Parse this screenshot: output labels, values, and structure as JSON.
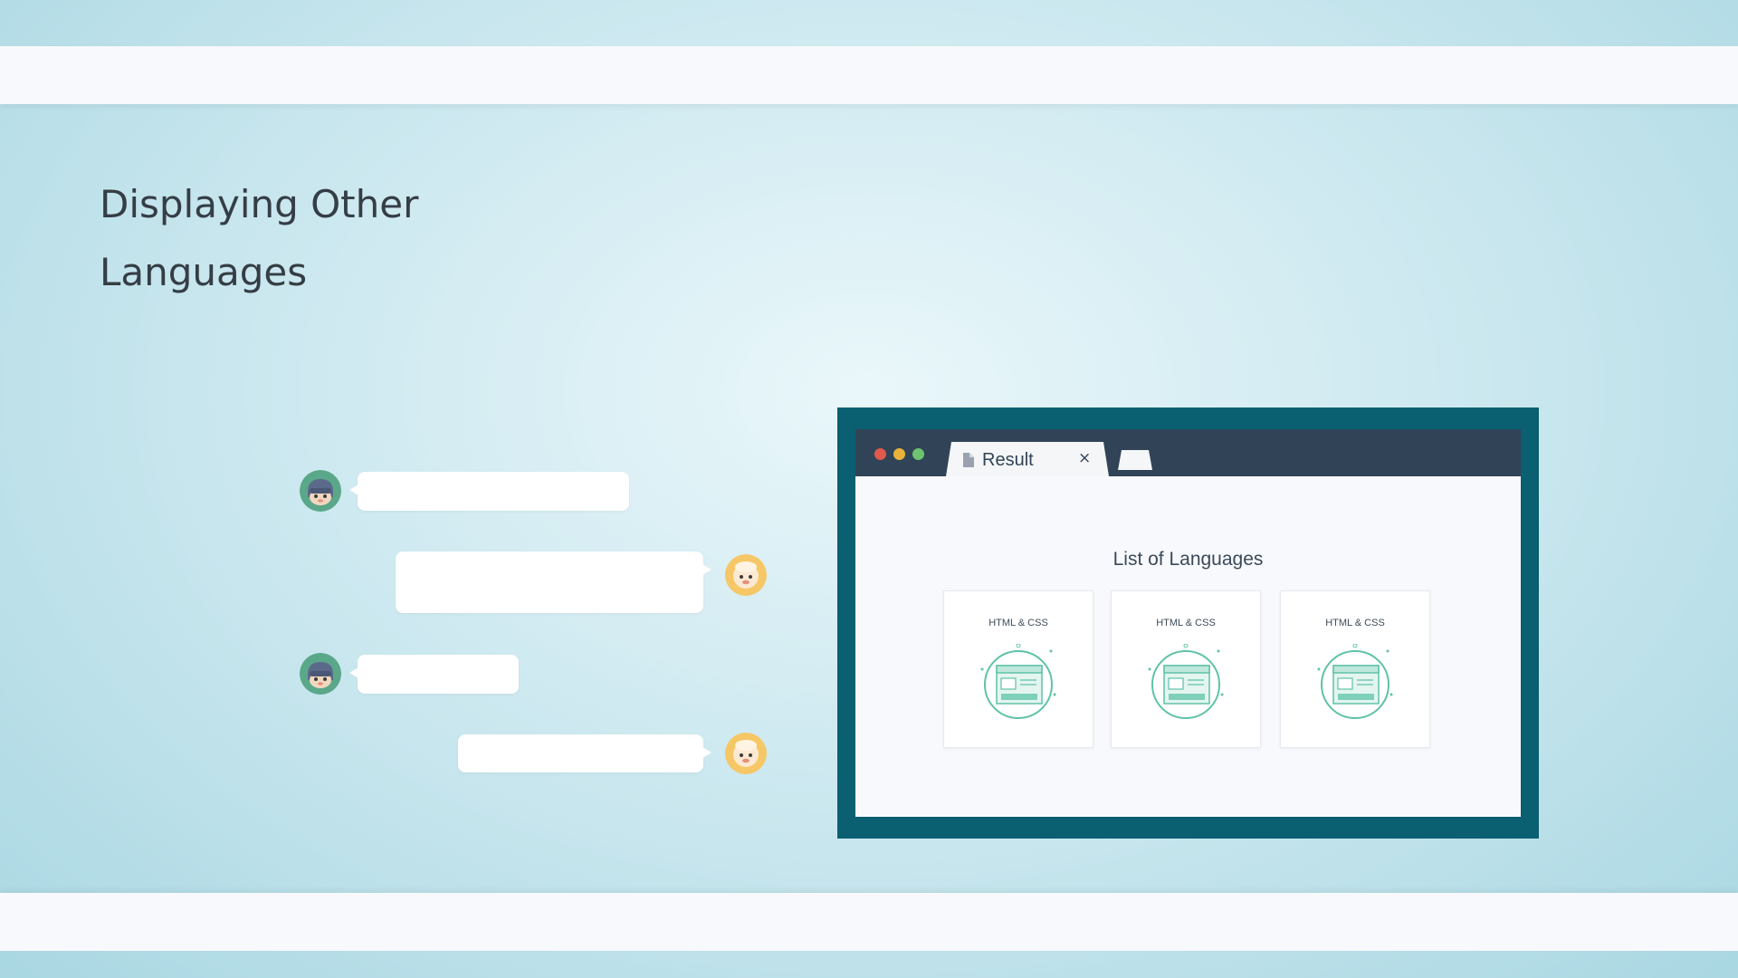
{
  "slide": {
    "title": "Displaying Other Languages"
  },
  "browser": {
    "tab_label": "Result",
    "tab_close_glyph": "×",
    "page_heading": "List of Languages",
    "cards": [
      {
        "label": "HTML & CSS",
        "icon": "webpage-illustration-icon"
      },
      {
        "label": "HTML & CSS",
        "icon": "webpage-illustration-icon"
      },
      {
        "label": "HTML & CSS",
        "icon": "webpage-illustration-icon"
      }
    ]
  },
  "chat": {
    "messages": [
      {
        "speaker": "ninja-avatar",
        "side": "left",
        "text": ""
      },
      {
        "speaker": "sheep-avatar",
        "side": "right",
        "text": ""
      },
      {
        "speaker": "ninja-avatar",
        "side": "left",
        "text": ""
      },
      {
        "speaker": "sheep-avatar",
        "side": "right",
        "text": ""
      }
    ]
  },
  "colors": {
    "frame": "#0a5f71",
    "browser_bar": "#314457",
    "accent": "#5fc2a8",
    "dot_red": "#e0594c",
    "dot_yellow": "#e9b23b",
    "dot_green": "#6cc470"
  }
}
